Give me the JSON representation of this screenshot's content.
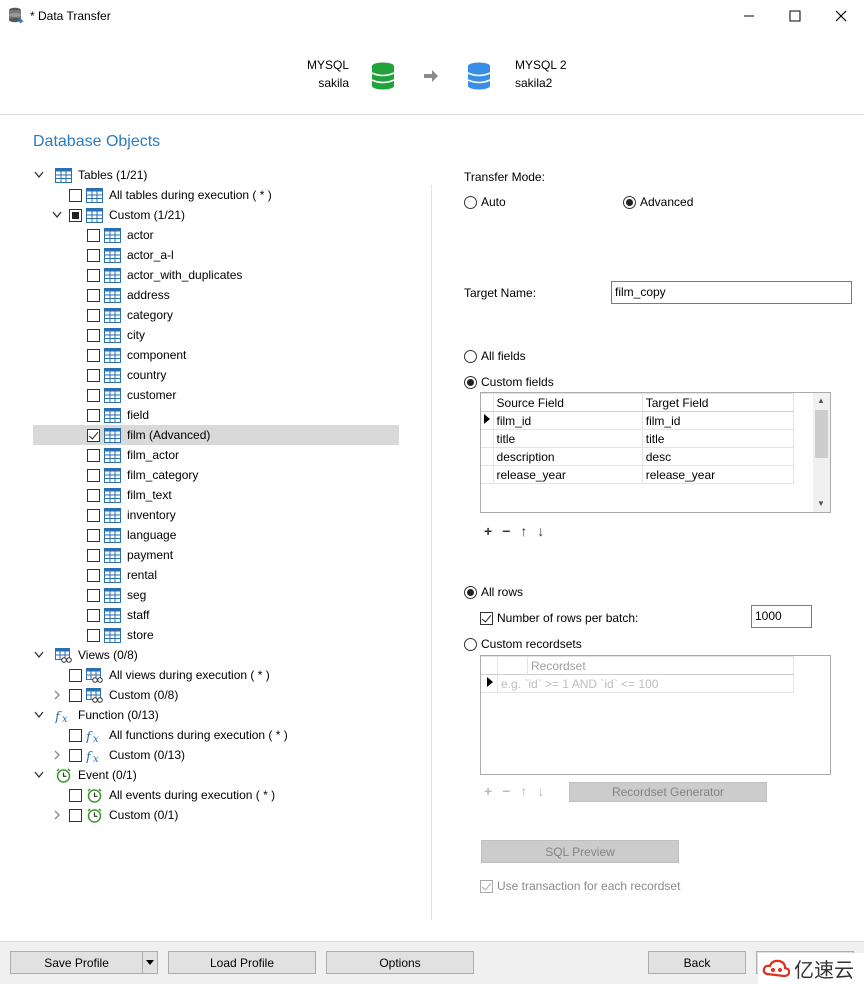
{
  "window": {
    "title": "* Data Transfer"
  },
  "header": {
    "source": {
      "connection": "MYSQL",
      "database": "sakila"
    },
    "target": {
      "connection": "MYSQL 2",
      "database": "sakila2"
    }
  },
  "left": {
    "section_title": "Database Objects",
    "tree": [
      {
        "label": "Tables (1/21)"
      },
      {
        "label": "All tables during execution ( * )"
      },
      {
        "label": "Custom (1/21)"
      },
      {
        "label": "actor"
      },
      {
        "label": "actor_a-l"
      },
      {
        "label": "actor_with_duplicates"
      },
      {
        "label": "address"
      },
      {
        "label": "category"
      },
      {
        "label": "city"
      },
      {
        "label": "component"
      },
      {
        "label": "country"
      },
      {
        "label": "customer"
      },
      {
        "label": "field"
      },
      {
        "label": "film (Advanced)"
      },
      {
        "label": "film_actor"
      },
      {
        "label": "film_category"
      },
      {
        "label": "film_text"
      },
      {
        "label": "inventory"
      },
      {
        "label": "language"
      },
      {
        "label": "payment"
      },
      {
        "label": "rental"
      },
      {
        "label": "seg"
      },
      {
        "label": "staff"
      },
      {
        "label": "store"
      },
      {
        "label": "Views (0/8)"
      },
      {
        "label": "All views during execution ( * )"
      },
      {
        "label": "Custom (0/8)"
      },
      {
        "label": "Function (0/13)"
      },
      {
        "label": "All functions during execution ( * )"
      },
      {
        "label": "Custom (0/13)"
      },
      {
        "label": "Event (0/1)"
      },
      {
        "label": "All events during execution ( * )"
      },
      {
        "label": "Custom (0/1)"
      }
    ]
  },
  "right": {
    "transfer_mode_label": "Transfer Mode:",
    "mode_auto": "Auto",
    "mode_advanced": "Advanced",
    "target_name_label": "Target Name:",
    "target_name_value": "film_copy",
    "all_fields": "All fields",
    "custom_fields": "Custom fields",
    "fields_grid": {
      "headers": [
        "Source Field",
        "Target Field"
      ],
      "rows": [
        [
          "film_id",
          "film_id"
        ],
        [
          "title",
          "title"
        ],
        [
          "description",
          "desc"
        ],
        [
          "release_year",
          "release_year"
        ]
      ]
    },
    "all_rows": "All rows",
    "rows_per_batch_label": "Number of rows per batch:",
    "rows_per_batch_value": "1000",
    "custom_recordsets": "Custom recordsets",
    "recordset_header": "Recordset",
    "recordset_placeholder": "e.g. `id` >= 1 AND `id` <= 100",
    "recordset_generator": "Recordset Generator",
    "sql_preview": "SQL Preview",
    "use_transaction": "Use transaction for each recordset"
  },
  "footer": {
    "save_profile": "Save Profile",
    "load_profile": "Load Profile",
    "options": "Options",
    "back": "Back"
  },
  "watermark": {
    "text": "亿速云"
  },
  "colors": {
    "accent": "#2a7bc0",
    "source_db": "#1fa33a",
    "target_db": "#3a8ee6"
  }
}
